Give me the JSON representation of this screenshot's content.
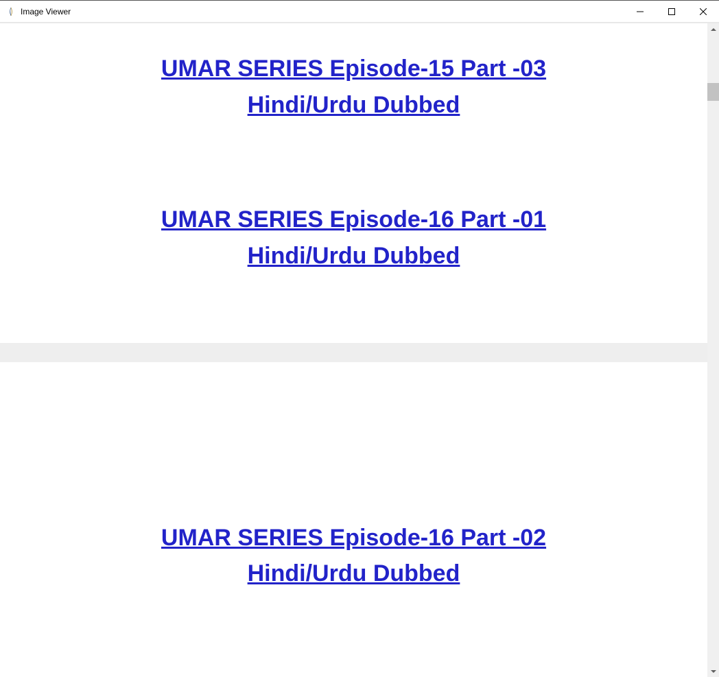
{
  "window": {
    "title": "Image Viewer"
  },
  "links": [
    {
      "line1": "UMAR SERIES Episode-15 Part -03",
      "line2": "Hindi/Urdu Dubbed"
    },
    {
      "line1": "UMAR SERIES Episode-16 Part -01",
      "line2": "Hindi/Urdu Dubbed"
    },
    {
      "line1": "UMAR SERIES Episode-16 Part -02",
      "line2": "Hindi/Urdu Dubbed"
    }
  ]
}
